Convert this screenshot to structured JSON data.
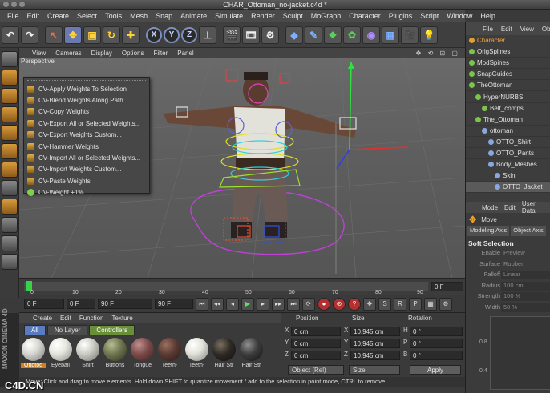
{
  "window": {
    "title": "CHAR_Ottoman_no-jacket.c4d *"
  },
  "menubar": [
    "File",
    "Edit",
    "Create",
    "Select",
    "Tools",
    "Mesh",
    "Snap",
    "Animate",
    "Simulate",
    "Render",
    "Sculpt",
    "MoGraph",
    "Character",
    "Plugins",
    "Script",
    "Window",
    "Help"
  ],
  "toolbar": {
    "x_label": "X",
    "y_label": "Y",
    "z_label": "Z"
  },
  "viewport": {
    "label": "Perspective",
    "menu": [
      "View",
      "Cameras",
      "Display",
      "Options",
      "Filter",
      "Panel"
    ],
    "icons": "✥ ⟲ ⊡ ▢"
  },
  "popup_menu": {
    "items": [
      {
        "label": "CV-Apply Weights To Selection",
        "icon": "weights-icon"
      },
      {
        "label": "CV-Blend Weights Along Path",
        "icon": "weights-icon"
      },
      {
        "label": "CV-Copy Weights",
        "icon": "weights-icon"
      },
      {
        "label": "CV-Export All or Selected Weights...",
        "icon": "weights-icon"
      },
      {
        "label": "CV-Export Weights Custom...",
        "icon": "weights-icon"
      },
      {
        "label": "CV-Hammer Weights",
        "icon": "weights-icon"
      },
      {
        "label": "CV-Import All or Selected Weights...",
        "icon": "weights-icon"
      },
      {
        "label": "CV-Import Weights Custom...",
        "icon": "weights-icon"
      },
      {
        "label": "CV-Paste Weights",
        "icon": "weights-icon"
      },
      {
        "label": "CV-Weight +1%",
        "icon": "plus-circle-icon"
      }
    ]
  },
  "timeline": {
    "ticks": [
      "0",
      "10",
      "20",
      "30",
      "40",
      "50",
      "60",
      "70",
      "80",
      "90"
    ],
    "current_frame": "0 F"
  },
  "transport": {
    "start_field": "0 F",
    "range_start": "0 F",
    "range_end": "90 F",
    "end_field": "90 F"
  },
  "material_manager": {
    "menu": [
      "Create",
      "Edit",
      "Function",
      "Texture"
    ],
    "layers": [
      "All",
      "No Layer",
      "Controllers"
    ],
    "materials": [
      {
        "name": "Ottotoo",
        "color": "#d8d8d4",
        "selected": true
      },
      {
        "name": "Eyeball",
        "color": "#e8e8e0",
        "selected": false
      },
      {
        "name": "Shirt",
        "color": "#cfcfc8",
        "selected": false
      },
      {
        "name": "Buttons",
        "color": "#6e7450",
        "selected": false
      },
      {
        "name": "Tongue",
        "color": "#7a4a48",
        "selected": false
      },
      {
        "name": "Teeth-",
        "color": "#5a3a32",
        "selected": false
      },
      {
        "name": "Teeth-",
        "color": "#e4e4dc",
        "selected": false
      },
      {
        "name": "Hair Str",
        "color": "#2e2a24",
        "selected": false
      },
      {
        "name": "Hair Str",
        "color": "#3c3c3c",
        "selected": false
      }
    ]
  },
  "coordinates": {
    "headers": {
      "position": "Position",
      "size": "Size",
      "rotation": "Rotation"
    },
    "rows": [
      {
        "axis": "X",
        "pos": "0 cm",
        "size": "10.945 cm",
        "rot_axis": "H",
        "rot": "0 °"
      },
      {
        "axis": "Y",
        "pos": "0 cm",
        "size": "10.945 cm",
        "rot_axis": "P",
        "rot": "0 °"
      },
      {
        "axis": "Z",
        "pos": "0 cm",
        "size": "10.945 cm",
        "rot_axis": "B",
        "rot": "0 °"
      }
    ],
    "mode_select": "Object (Rel)",
    "size_select": "Size",
    "apply_label": "Apply"
  },
  "statusbar": {
    "text": "Move: Click and drag to move elements. Hold down SHIFT to quantize movement / add to the selection in point mode, CTRL to remove."
  },
  "brand": {
    "vertical": "MAXON CINEMA 4D",
    "watermark": "C4D.CN"
  },
  "object_manager": {
    "menu": [
      "File",
      "Edit",
      "View",
      "Objects"
    ],
    "items": [
      {
        "label": "Character",
        "indent": 0,
        "dot": "orange",
        "state": "hl"
      },
      {
        "label": "OrigSplines",
        "indent": 0,
        "dot": "green",
        "state": ""
      },
      {
        "label": "ModSpines",
        "indent": 0,
        "dot": "green",
        "state": ""
      },
      {
        "label": "SnapGuides",
        "indent": 0,
        "dot": "green",
        "state": ""
      },
      {
        "label": "TheOttoman",
        "indent": 0,
        "dot": "green",
        "state": ""
      },
      {
        "label": "HyperNURBS",
        "indent": 1,
        "dot": "green",
        "state": ""
      },
      {
        "label": "Belt_comps",
        "indent": 2,
        "dot": "green",
        "state": ""
      },
      {
        "label": "The_Ottoman",
        "indent": 1,
        "dot": "green",
        "state": ""
      },
      {
        "label": "ottoman",
        "indent": 2,
        "dot": "blue",
        "state": ""
      },
      {
        "label": "OTTO_Shirt",
        "indent": 3,
        "dot": "blue",
        "state": ""
      },
      {
        "label": "OTTO_Pants",
        "indent": 3,
        "dot": "blue",
        "state": ""
      },
      {
        "label": "Body_Meshes",
        "indent": 3,
        "dot": "blue",
        "state": ""
      },
      {
        "label": "Skin",
        "indent": 4,
        "dot": "blue",
        "state": ""
      },
      {
        "label": "OTTO_Jacket",
        "indent": 4,
        "dot": "blue",
        "state": "sel"
      }
    ]
  },
  "attribute_manager": {
    "menu": [
      "Mode",
      "Edit",
      "User Data"
    ],
    "tool": "Move",
    "tabs": [
      "Modeling Axis",
      "Object Axis"
    ],
    "section": "Soft Selection",
    "rows": [
      {
        "label": "Enable",
        "value": "Preview"
      },
      {
        "label": "Surface",
        "value": "Rubber"
      },
      {
        "label": "Falloff",
        "value": "Linear"
      },
      {
        "label": "Radius",
        "value": "100 cm"
      },
      {
        "label": "Strength",
        "value": "100 %"
      },
      {
        "label": "Width",
        "value": "50 %"
      }
    ],
    "graph_labels": [
      "0.8",
      "0.4"
    ]
  }
}
